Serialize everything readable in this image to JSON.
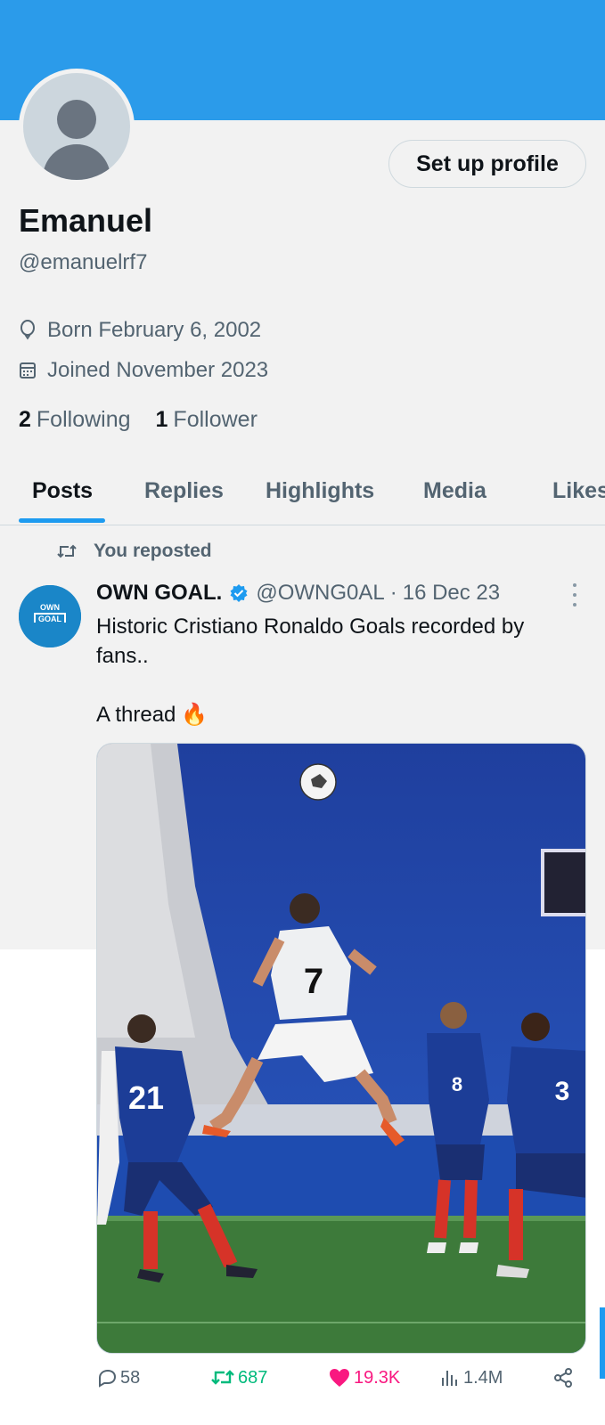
{
  "colors": {
    "banner": "#2b9bea",
    "accent": "#1d9bf0",
    "repost_green": "#00ba7c",
    "like_pink": "#f91880",
    "muted": "#536471"
  },
  "profile": {
    "name": "Emanuel",
    "handle": "@emanuelrf7",
    "setup_button": "Set up profile",
    "born": "Born February 6, 2002",
    "joined": "Joined November 2023",
    "following_count": "2",
    "following_label": "Following",
    "followers_count": "1",
    "followers_label": "Follower"
  },
  "tabs": [
    {
      "label": "Posts",
      "active": true
    },
    {
      "label": "Replies",
      "active": false
    },
    {
      "label": "Highlights",
      "active": false
    },
    {
      "label": "Media",
      "active": false
    },
    {
      "label": "Likes",
      "active": false
    }
  ],
  "post": {
    "repost_label": "You reposted",
    "author_name": "OWN GOAL.",
    "author_handle": "@OWNG0AL",
    "separator": "·",
    "date": "16 Dec 23",
    "avatar_text_top": "OWN",
    "avatar_text_bottom": "GOAL",
    "text": "Historic Cristiano Ronaldo Goals recorded by fans..",
    "thread_text": "A thread",
    "thread_emoji": "🔥",
    "media_description_icon": "football-photo",
    "stats": {
      "replies": "58",
      "reposts": "687",
      "likes": "19.3K",
      "views": "1.4M"
    }
  }
}
